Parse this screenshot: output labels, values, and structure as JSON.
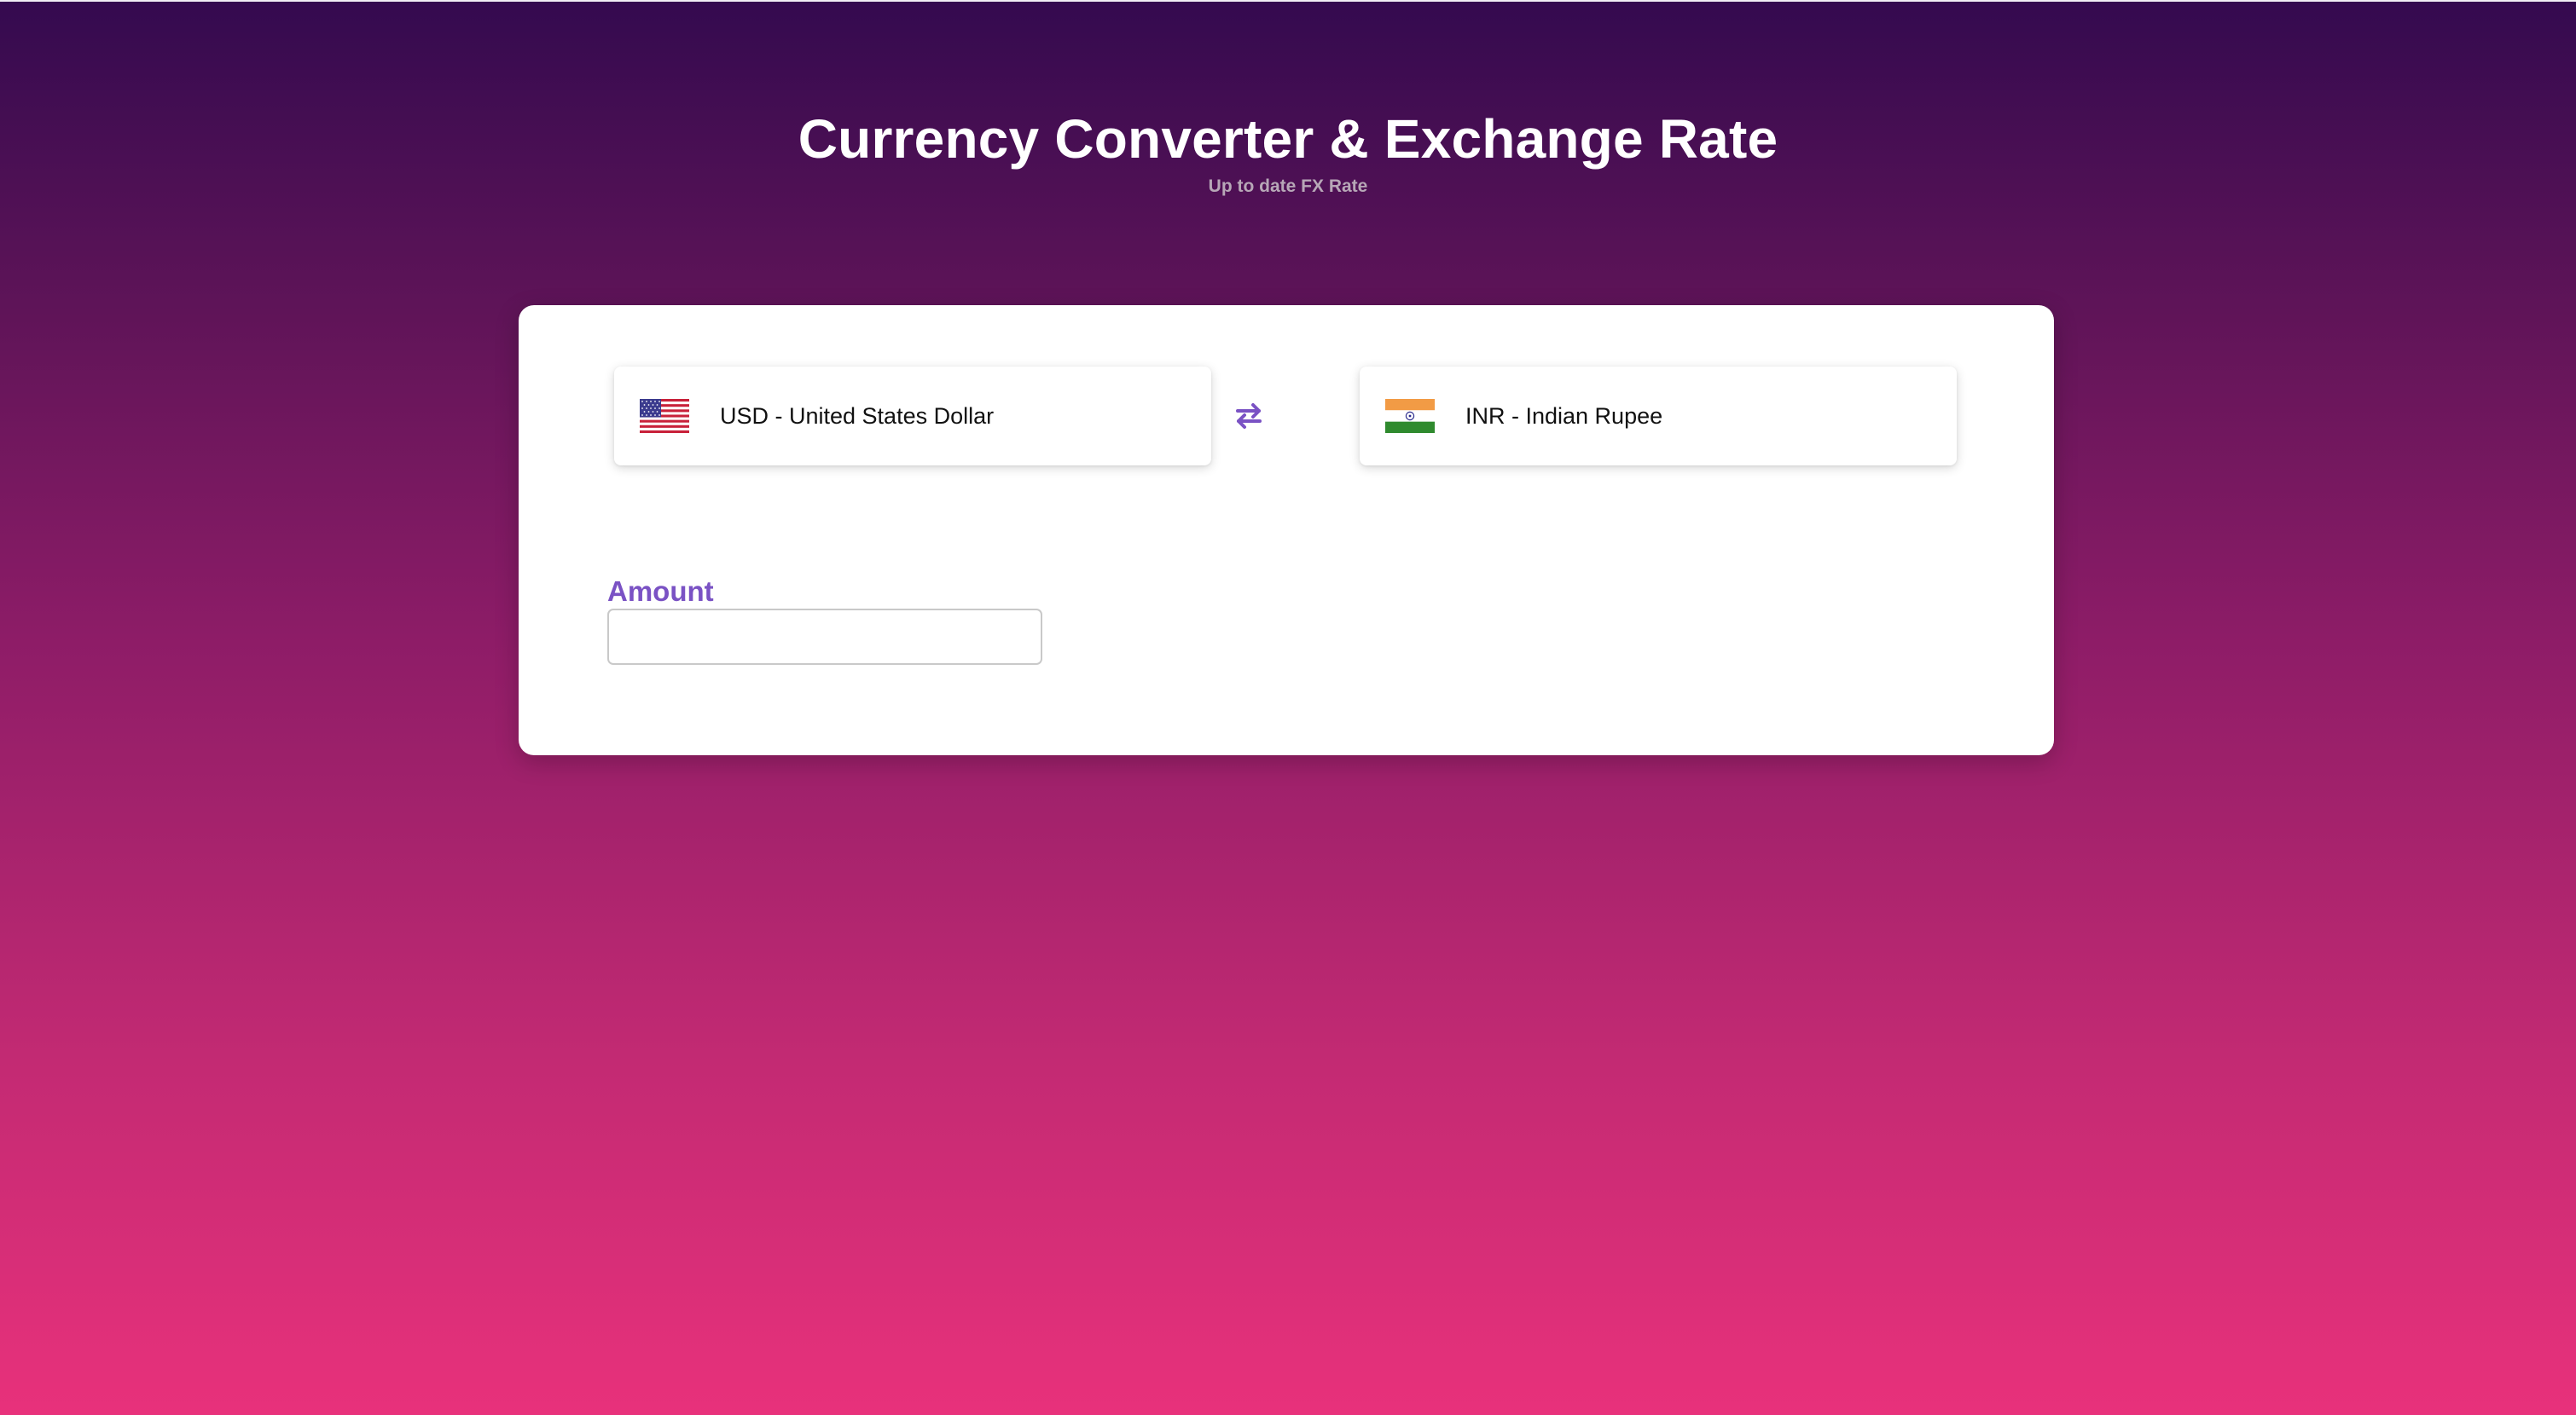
{
  "header": {
    "title": "Currency Converter & Exchange Rate",
    "subtitle": "Up to date FX Rate"
  },
  "converter": {
    "from": {
      "label": "USD - United States Dollar",
      "flag_icon": "us-flag-icon"
    },
    "swap_icon": "swap-arrows-icon",
    "to": {
      "label": "INR - Indian Rupee",
      "flag_icon": "india-flag-icon"
    },
    "amount": {
      "label": "Amount",
      "value": "",
      "placeholder": ""
    }
  },
  "colors": {
    "background_top": "#340a4f",
    "background_bottom": "#e8317b",
    "accent": "#7a52c4",
    "card": "#ffffff"
  }
}
